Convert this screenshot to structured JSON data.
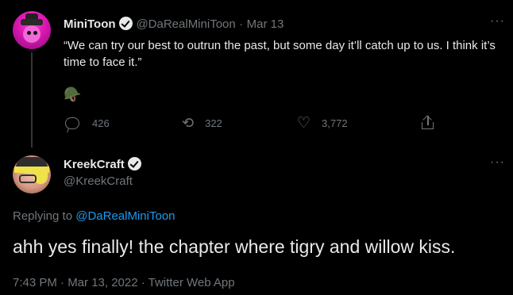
{
  "parent_tweet": {
    "display_name": "MiniToon",
    "handle": "@DaRealMiniToon",
    "separator": "·",
    "date": "Mar 13",
    "text": "“We can try our best to outrun the past, but some day it’ll catch up to us. I think it’s time to face it.”",
    "emoji": "🪖",
    "more": "···",
    "replies": "426",
    "retweets": "322",
    "likes": "3,772"
  },
  "main_tweet": {
    "display_name": "KreekCraft",
    "handle": "@KreekCraft",
    "more": "···",
    "replying_prefix": "Replying to",
    "replying_to": "@DaRealMiniToon",
    "text": "ahh yes finally! the chapter where tigry and willow kiss.",
    "timestamp": "7:43 PM · Mar 13, 2022 · Twitter Web App"
  },
  "icons": {
    "verified": "verified-badge-icon",
    "reply": "reply-icon",
    "retweet": "retweet-icon",
    "like": "heart-icon",
    "share": "share-icon",
    "more": "more-icon"
  },
  "colors": {
    "background": "#000000",
    "text": "#e7e9ea",
    "secondary": "#71767b",
    "link": "#1d9bf0"
  }
}
